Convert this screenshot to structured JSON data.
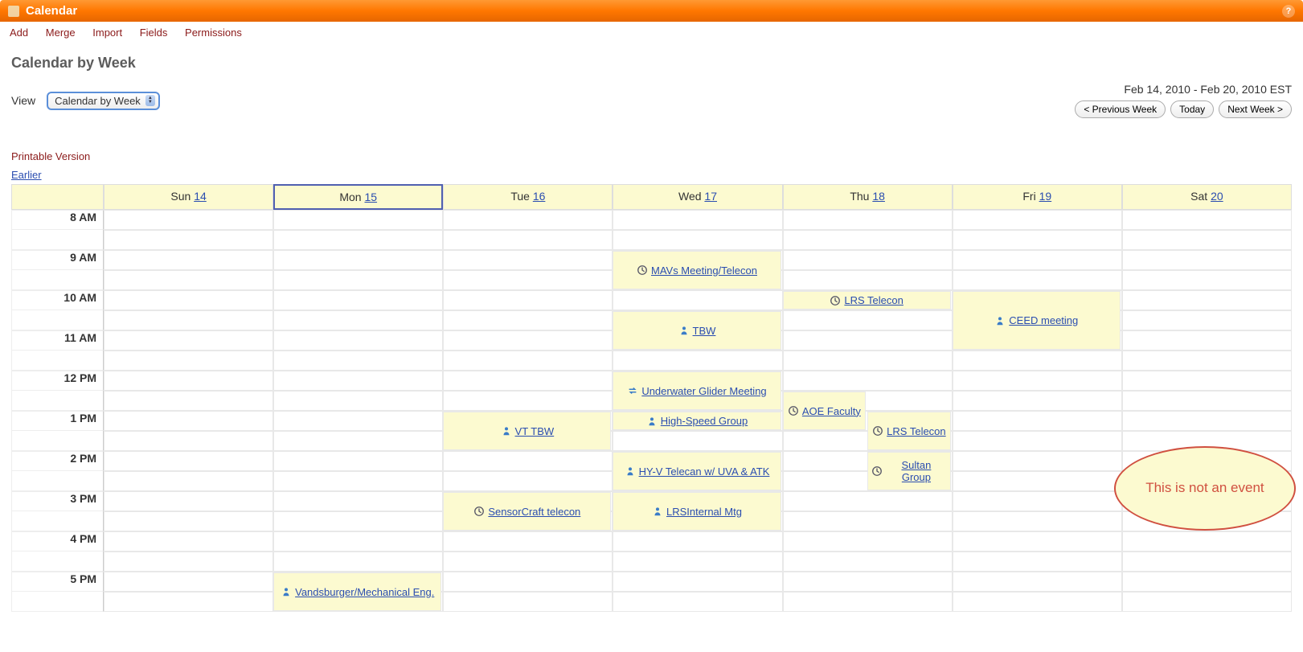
{
  "titlebar": {
    "title": "Calendar"
  },
  "toolbar": {
    "items": [
      "Add",
      "Merge",
      "Import",
      "Fields",
      "Permissions"
    ]
  },
  "page": {
    "heading": "Calendar by Week",
    "view_label": "View",
    "view_selected": "Calendar by Week",
    "date_range": "Feb 14, 2010 - Feb 20, 2010 EST",
    "prev_btn": "< Previous Week",
    "today_btn": "Today",
    "next_btn": "Next Week >",
    "printable": "Printable Version",
    "earlier": "Earlier"
  },
  "days": [
    {
      "label": "Sun",
      "num": "14"
    },
    {
      "label": "Mon",
      "num": "15"
    },
    {
      "label": "Tue",
      "num": "16"
    },
    {
      "label": "Wed",
      "num": "17"
    },
    {
      "label": "Thu",
      "num": "18"
    },
    {
      "label": "Fri",
      "num": "19"
    },
    {
      "label": "Sat",
      "num": "20"
    }
  ],
  "hours": [
    "8 AM",
    "9 AM",
    "10 AM",
    "11 AM",
    "12 PM",
    "1 PM",
    "2 PM",
    "3 PM",
    "4 PM",
    "5 PM"
  ],
  "events": {
    "mavs": "MAVs Meeting/Telecon",
    "lrs1": "LRS Telecon",
    "ceed": "CEED meeting",
    "tbw": "TBW",
    "glider": "Underwater Glider Meeting",
    "vttbw": "VT TBW",
    "hsgroup": "High-Speed Group",
    "aoe": "AOE Faculty",
    "lrs2": "LRS Telecon",
    "hyv": "HY-V Telecan w/ UVA & ATK",
    "sultan": "Sultan Group",
    "sensor": "SensorCraft telecon",
    "lrsint": "LRSInternal Mtg",
    "vands": "Vandsburger/Mechanical Eng."
  },
  "annotation": {
    "text": "This is not an event"
  }
}
